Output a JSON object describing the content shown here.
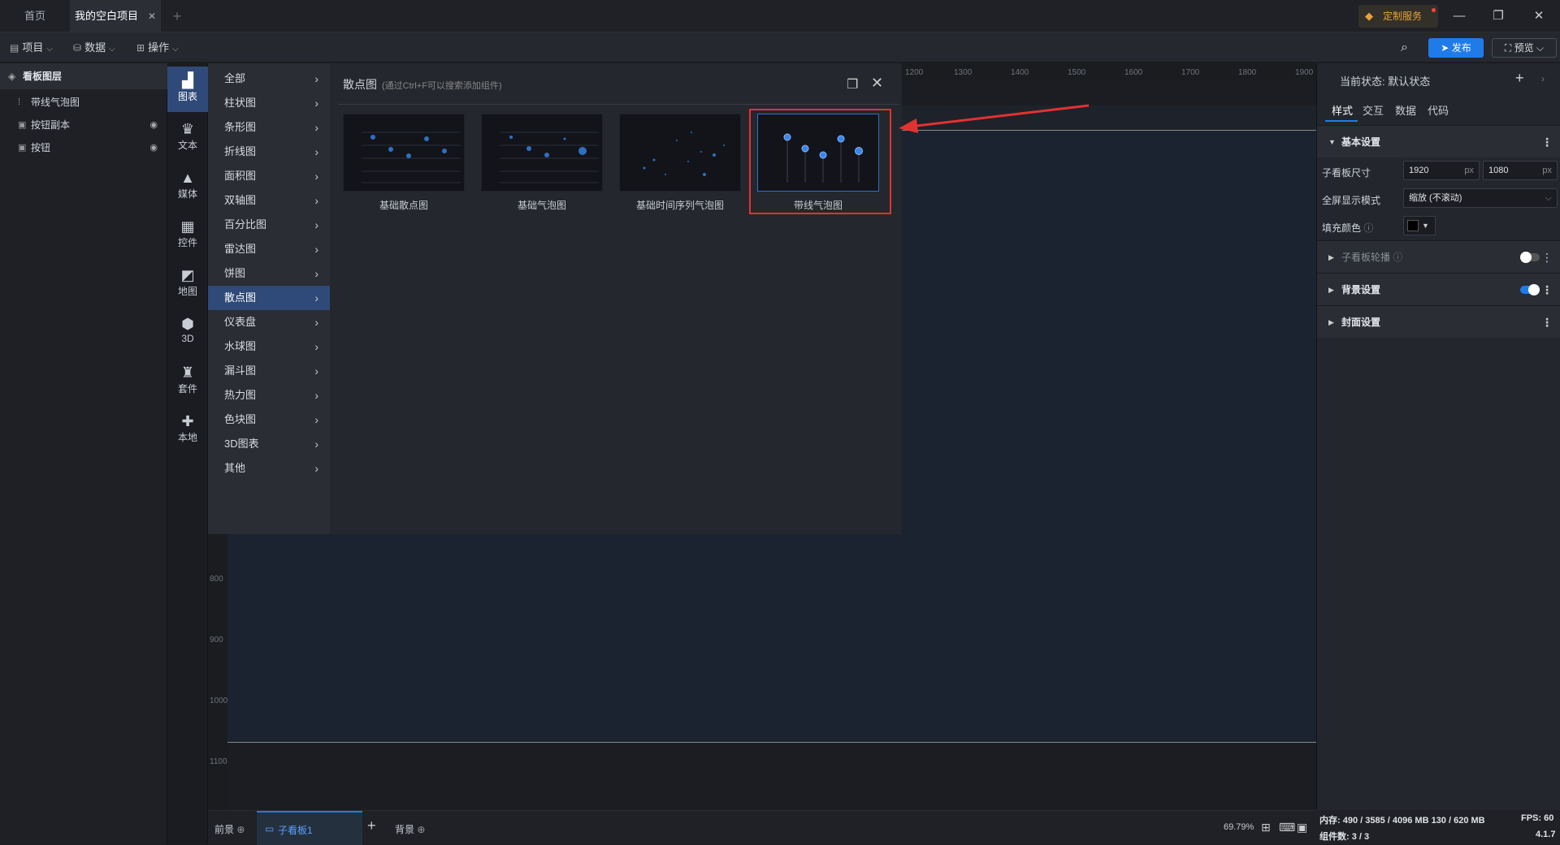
{
  "titlebar": {
    "tabs": [
      {
        "label": "首页"
      },
      {
        "label": "我的空白项目"
      }
    ],
    "new_tab": "+",
    "custom_service": "定制服务"
  },
  "toolbar": {
    "project": "项目",
    "data": "数据",
    "operation": "操作",
    "publish": "发布",
    "preview": "预览"
  },
  "layers": {
    "title": "看板图层",
    "items": [
      {
        "label": "带线气泡图",
        "icon": "scatter-chart-icon"
      },
      {
        "label": "按钮副本",
        "icon": "button-icon",
        "hidden": true
      },
      {
        "label": "按钮",
        "icon": "button-icon",
        "hidden": true
      }
    ]
  },
  "rail": {
    "items": [
      {
        "label": "图表",
        "icon": "bar-chart-icon"
      },
      {
        "label": "文本",
        "icon": "text-icon"
      },
      {
        "label": "媒体",
        "icon": "media-icon"
      },
      {
        "label": "控件",
        "icon": "widget-icon"
      },
      {
        "label": "地图",
        "icon": "map-icon"
      },
      {
        "label": "3D",
        "icon": "cube-icon"
      },
      {
        "label": "套件",
        "icon": "kit-icon"
      },
      {
        "label": "本地",
        "icon": "puzzle-icon"
      }
    ]
  },
  "submenu": {
    "items": [
      "全部",
      "柱状图",
      "条形图",
      "折线图",
      "面积图",
      "双轴图",
      "百分比图",
      "雷达图",
      "饼图",
      "散点图",
      "仪表盘",
      "水球图",
      "漏斗图",
      "热力图",
      "色块图",
      "3D图表",
      "其他"
    ],
    "active": "散点图"
  },
  "gallery": {
    "title": "散点图",
    "hint": "(通过Ctrl+F可以搜索添加组件)",
    "cards": [
      {
        "label": "基础散点图"
      },
      {
        "label": "基础气泡图"
      },
      {
        "label": "基础时间序列气泡图"
      },
      {
        "label": "带线气泡图"
      }
    ]
  },
  "ruler": {
    "top": [
      "1200",
      "1300",
      "1400",
      "1500",
      "1600",
      "1700",
      "1800",
      "1900"
    ],
    "left": [
      "800",
      "900",
      "1000",
      "1100"
    ]
  },
  "right": {
    "state_label": "当前状态:",
    "state_value": "默认状态",
    "tabs": [
      "样式",
      "交互",
      "数据",
      "代码"
    ],
    "basic": "基本设置",
    "board_size_label": "子看板尺寸",
    "width": "1920",
    "height": "1080",
    "unit": "px",
    "fullscreen_label": "全屏显示模式",
    "fullscreen_value": "缩放 (不滚动)",
    "fill_label": "填充颜色",
    "carousel": "子看板轮播",
    "background": "背景设置",
    "cover": "封面设置"
  },
  "status": {
    "foreground": "前景",
    "subboard": "子看板1",
    "background": "背景",
    "zoom": "69.79%",
    "memory": "内存: 490 / 3585 / 4096 MB 130 / 620 MB",
    "fps": "FPS: 60",
    "components": "组件数: 3 / 3",
    "version": "4.1.7"
  }
}
